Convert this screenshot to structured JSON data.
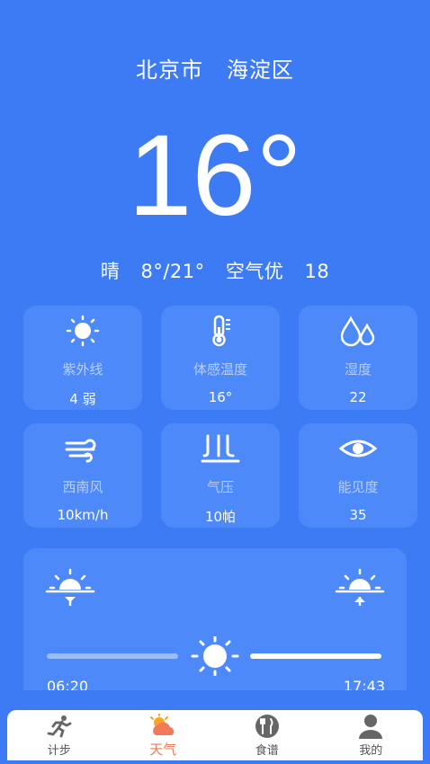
{
  "location": {
    "city": "北京市",
    "district": "海淀区"
  },
  "current": {
    "temperature": "16°"
  },
  "summary": {
    "condition": "晴",
    "range": "8°/21°",
    "aqi_label": "空气优",
    "aqi_value": "18"
  },
  "metrics": [
    {
      "icon": "sun-icon",
      "label": "紫外线",
      "value": "4 弱"
    },
    {
      "icon": "thermometer-icon",
      "label": "体感温度",
      "value": "16°"
    },
    {
      "icon": "droplets-icon",
      "label": "湿度",
      "value": "22"
    },
    {
      "icon": "wind-icon",
      "label": "西南风",
      "value": "10km/h"
    },
    {
      "icon": "pressure-icon",
      "label": "气压",
      "value": "10帕"
    },
    {
      "icon": "eye-icon",
      "label": "能见度",
      "value": "35"
    }
  ],
  "sun": {
    "sunrise": "06:20",
    "sunset": "17:43"
  },
  "tabs": [
    {
      "icon": "running-icon",
      "label": "计步",
      "active": false
    },
    {
      "icon": "cloud-sun-icon",
      "label": "天气",
      "active": true
    },
    {
      "icon": "utensils-icon",
      "label": "食谱",
      "active": false
    },
    {
      "icon": "user-icon",
      "label": "我的",
      "active": false
    }
  ],
  "colors": {
    "background": "#3d7bf4",
    "card": "#4d89f8",
    "active_tab": "#f07a5a"
  }
}
